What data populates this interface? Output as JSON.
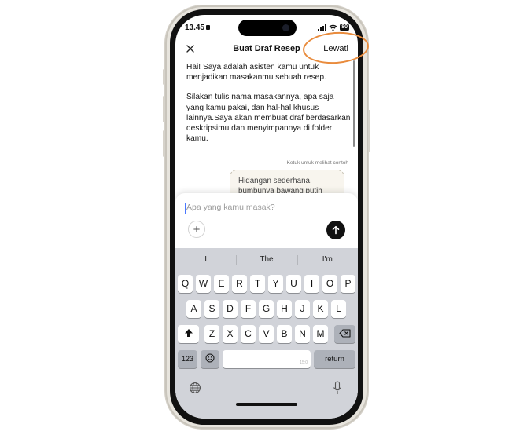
{
  "status_bar": {
    "time": "13.45",
    "battery": "80"
  },
  "header": {
    "title": "Buat Draf Resep",
    "skip_label": "Lewati"
  },
  "intro": {
    "p1": "Hai! Saya adalah asisten kamu untuk menjadikan masakanmu sebuah resep.",
    "p2": "Silakan tulis nama masakannya, apa saja yang kamu pakai, dan hal-hal khusus lainnya.Saya akan membuat draf berdasarkan deskripsimu dan menyimpannya di folder kamu."
  },
  "example": {
    "hint": "Ketuk untuk melihat contoh",
    "text": "Hidangan sederhana, bumbunya bawang putih"
  },
  "composer": {
    "placeholder": "Apa yang kamu masak?"
  },
  "keyboard": {
    "suggestions": [
      "I",
      "The",
      "I'm"
    ],
    "row1": [
      "Q",
      "W",
      "E",
      "R",
      "T",
      "Y",
      "U",
      "I",
      "O",
      "P"
    ],
    "row2": [
      "A",
      "S",
      "D",
      "F",
      "G",
      "H",
      "J",
      "K",
      "L"
    ],
    "row3": [
      "Z",
      "X",
      "C",
      "V",
      "B",
      "N",
      "M"
    ],
    "numbers_label": "123",
    "space_hint": "15:0",
    "return_label": "return"
  },
  "colors": {
    "highlight": "#e98b3c",
    "keyboard_bg": "#d1d3d9"
  },
  "icons": [
    "close-icon",
    "lock-icon",
    "signal-icon",
    "wifi-icon",
    "battery-icon",
    "plus-icon",
    "arrow-up-icon",
    "shift-icon",
    "backspace-icon",
    "emoji-icon",
    "globe-icon",
    "microphone-icon"
  ]
}
